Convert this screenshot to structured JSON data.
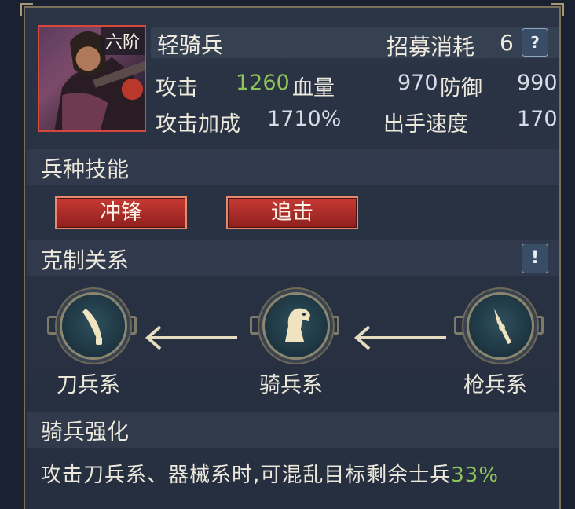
{
  "unit": {
    "rank": "六阶",
    "name": "轻骑兵",
    "recruit_label": "招募消耗",
    "recruit_value": "6",
    "help_icon": "?"
  },
  "stats": {
    "attack_label": "攻击",
    "attack_value": "1260",
    "hp_label": "血量",
    "hp_value": "970",
    "defense_label": "防御",
    "defense_value": "990",
    "attack_bonus_label": "攻击加成",
    "attack_bonus_value": "1710%",
    "speed_label": "出手速度",
    "speed_value": "170"
  },
  "skills": {
    "title": "兵种技能",
    "buttons": [
      "冲锋",
      "追击"
    ]
  },
  "counter": {
    "title": "克制关系",
    "info_icon": "!",
    "units": [
      {
        "label": "刀兵系",
        "icon": "blade-icon"
      },
      {
        "label": "骑兵系",
        "icon": "horse-icon"
      },
      {
        "label": "枪兵系",
        "icon": "spear-icon"
      }
    ]
  },
  "enhance": {
    "title": "骑兵强化",
    "desc_text": "攻击刀兵系、器械系时,可混乱目标剩余士兵",
    "desc_percent": "33%"
  },
  "colors": {
    "accent_green": "#8fc45a",
    "button_red": "#c83a34",
    "portrait_border": "#d9473c"
  }
}
